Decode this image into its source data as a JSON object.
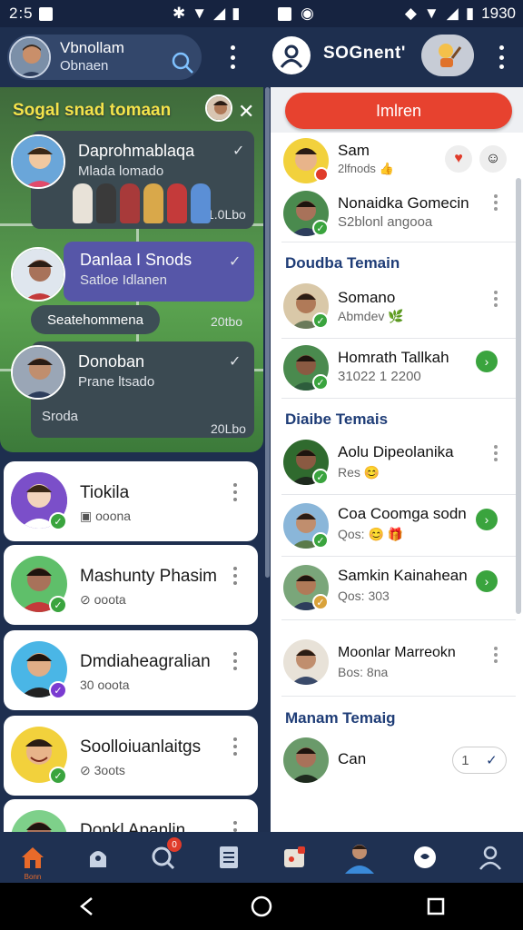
{
  "status_bar": {
    "time": "2:5",
    "clock_right": "1930"
  },
  "header": {
    "left_name": "Vbnollam",
    "left_sub": "Obnaen",
    "right_title": "SOGnent'"
  },
  "featured": {
    "title": "Sogal snad tomaan",
    "messages": [
      {
        "title": "Daprohmablaqa",
        "sub": "Mlada lomado",
        "time": "1.0Lbo"
      },
      {
        "title": "Danlaa I Snods",
        "sub": "Satloe Idlanen"
      },
      {
        "title": "Donoban",
        "sub": "Prane ltsado",
        "extra": "Sroda",
        "time": "20Lbo"
      }
    ],
    "pill_text": "Seatehommena",
    "pill_time": "20tbo"
  },
  "left_contacts": [
    {
      "name": "Tiokila",
      "sub": "ooona",
      "badge_color": "#3aa43e"
    },
    {
      "name": "Mashunty Phasim",
      "sub": "ooota",
      "badge_color": "#3aa43e"
    },
    {
      "name": "Dmdiaheagralian",
      "sub": "30 ooota",
      "badge_color": "#7a3bd1"
    },
    {
      "name": "Soolloiuanlaitgs",
      "sub": "3oots",
      "badge_color": "#3aa43e"
    },
    {
      "name": "Donkl Apanlin",
      "sub": ""
    }
  ],
  "right_panel": {
    "join_label": "Imlren",
    "top_contacts": [
      {
        "name": "Sam",
        "sub": "2lfnods"
      },
      {
        "name": "Nonaidka Gomecin",
        "sub": "S2blonl angooa"
      }
    ],
    "sections": [
      {
        "title": "Doudba Temain",
        "items": [
          {
            "name": "Somano",
            "sub": "Abmdev"
          },
          {
            "name": "Homrath Tallkah",
            "sub": "31022 1 2200"
          }
        ]
      },
      {
        "title": "Diaibe Temais",
        "items": [
          {
            "name": "Aolu Dipeolanika",
            "sub": "Res"
          },
          {
            "name": "Coa Coomga sodn",
            "sub": "Qos:"
          },
          {
            "name": "Samkin Kainahean",
            "sub": "Qos: 303"
          },
          {
            "name": "Moonlar Marreokn",
            "sub": "Bos: 8na"
          }
        ]
      },
      {
        "title": "Manam Temaig",
        "items": [
          {
            "name": "Can",
            "sub": "",
            "counter": "1"
          }
        ]
      }
    ]
  },
  "bottom_nav": {
    "home_label": "Bonn",
    "notif_count": "0"
  },
  "colors": {
    "accent": "#e7422f",
    "nav_bg": "#1f3152",
    "section_blue": "#1f3d77",
    "check_green": "#3aa43e"
  }
}
